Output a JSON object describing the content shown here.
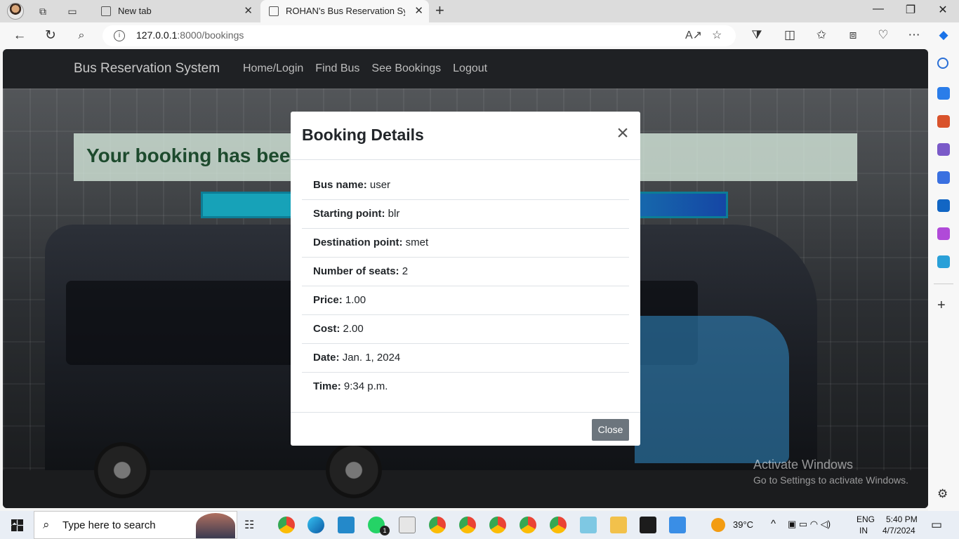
{
  "browser": {
    "tabs": [
      {
        "label": "New tab",
        "active": false
      },
      {
        "label": "ROHAN's Bus Reservation System",
        "active": true
      }
    ],
    "url_host": "127.0.0.1",
    "url_path": ":8000/bookings"
  },
  "navbar": {
    "brand": "Bus Reservation System",
    "links": [
      "Home/Login",
      "Find Bus",
      "See Bookings",
      "Logout"
    ]
  },
  "alert": {
    "text": "Your booking has been"
  },
  "modal": {
    "title": "Booking Details",
    "fields": [
      {
        "label": "Bus name:",
        "value": "user"
      },
      {
        "label": "Starting point:",
        "value": "blr"
      },
      {
        "label": "Destination point:",
        "value": "smet"
      },
      {
        "label": "Number of seats:",
        "value": "2"
      },
      {
        "label": "Price:",
        "value": "1.00"
      },
      {
        "label": "Cost:",
        "value": "2.00"
      },
      {
        "label": "Date:",
        "value": "Jan. 1, 2024"
      },
      {
        "label": "Time:",
        "value": "9:34 p.m."
      }
    ],
    "close_label": "Close"
  },
  "watermark": {
    "line1": "Activate Windows",
    "line2": "Go to Settings to activate Windows."
  },
  "taskbar": {
    "search_placeholder": "Type here to search",
    "weather": "39°C",
    "lang_line1": "ENG",
    "lang_line2": "IN",
    "time": "5:40 PM",
    "date": "4/7/2024",
    "whatsapp_badge": "1"
  }
}
